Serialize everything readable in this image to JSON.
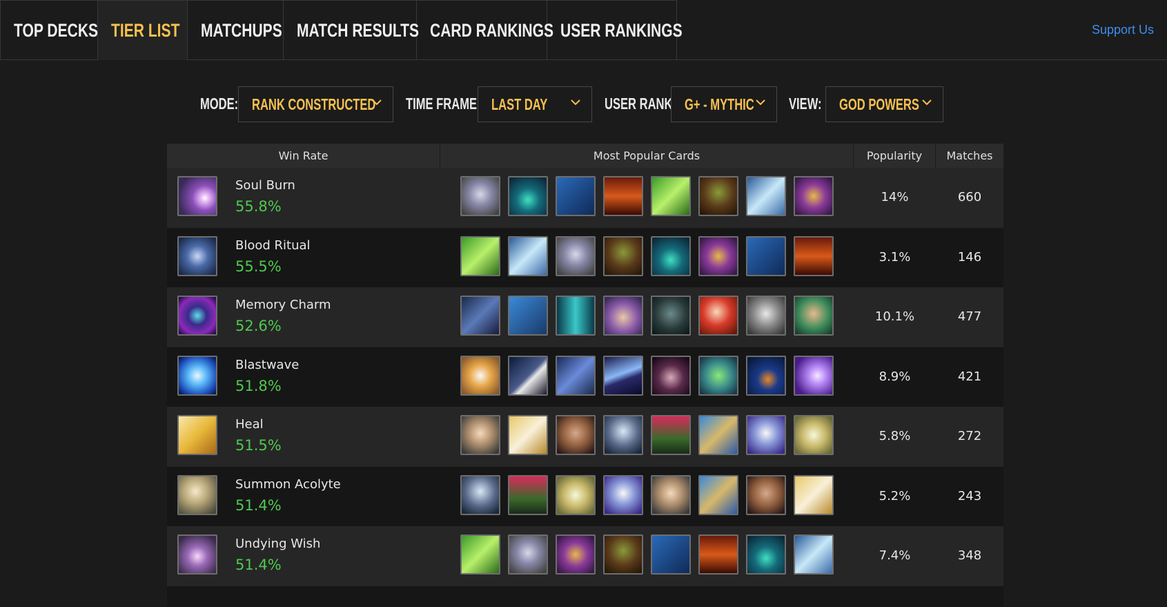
{
  "nav": {
    "tabs": [
      {
        "label": "TOP DECKS",
        "active": false
      },
      {
        "label": "TIER LIST",
        "active": true
      },
      {
        "label": "MATCHUPS",
        "active": false
      },
      {
        "label": "MATCH RESULTS",
        "active": false
      },
      {
        "label": "CARD RANKINGS",
        "active": false
      },
      {
        "label": "USER RANKINGS",
        "active": false
      }
    ],
    "support_label": "Support Us"
  },
  "filters": {
    "mode": {
      "label": "MODE:",
      "value": "RANK CONSTRUCTED"
    },
    "time_frame": {
      "label": "TIME FRAME:",
      "value": "LAST DAY"
    },
    "user_rank": {
      "label": "USER RANK:",
      "value": "G+ - MYTHIC"
    },
    "view": {
      "label": "VIEW:",
      "value": "GOD POWERS"
    }
  },
  "table": {
    "headers": {
      "win_rate": "Win Rate",
      "cards": "Most Popular Cards",
      "popularity": "Popularity",
      "matches": "Matches"
    },
    "rows": [
      {
        "name": "Soul Burn",
        "win_rate": "55.8%",
        "popularity": "14%",
        "matches": "660"
      },
      {
        "name": "Blood Ritual",
        "win_rate": "55.5%",
        "popularity": "3.1%",
        "matches": "146"
      },
      {
        "name": "Memory Charm",
        "win_rate": "52.6%",
        "popularity": "10.1%",
        "matches": "477"
      },
      {
        "name": "Blastwave",
        "win_rate": "51.8%",
        "popularity": "8.9%",
        "matches": "421"
      },
      {
        "name": "Heal",
        "win_rate": "51.5%",
        "popularity": "5.8%",
        "matches": "272"
      },
      {
        "name": "Summon Acolyte",
        "win_rate": "51.4%",
        "popularity": "5.2%",
        "matches": "243"
      },
      {
        "name": "Undying Wish",
        "win_rate": "51.4%",
        "popularity": "7.4%",
        "matches": "348"
      }
    ]
  },
  "colors": {
    "accent": "#f6c150",
    "win_rate": "#4ec94e",
    "link": "#3d8ef0"
  }
}
